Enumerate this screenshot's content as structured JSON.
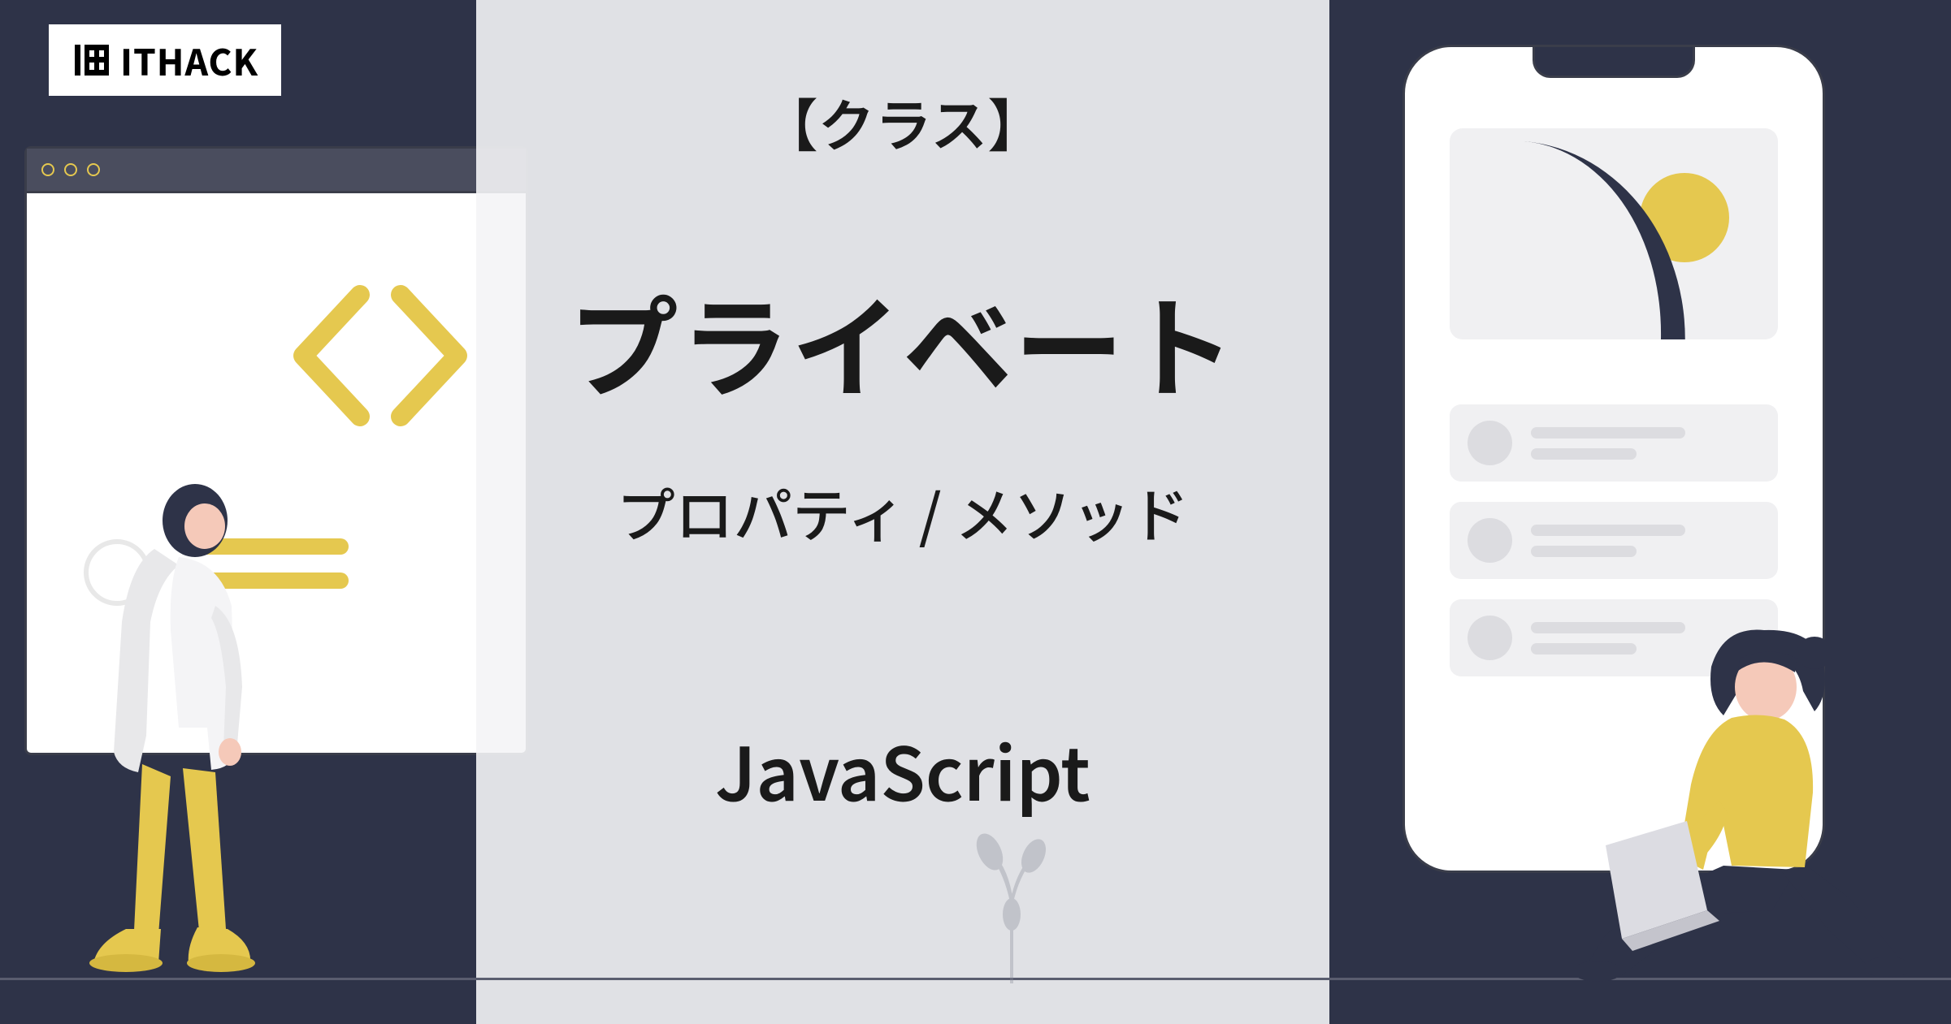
{
  "logo": {
    "text": "ITHACK",
    "icon": "ithack-logo-icon"
  },
  "content": {
    "tag": "【クラス】",
    "title": "プライベート",
    "subtitle": "プロパティ / メソッド",
    "footer": "JavaScript"
  },
  "colors": {
    "background": "#2e3348",
    "accent": "#e5c84f",
    "panel": "#f4f4f6",
    "text": "#1a1a1a"
  },
  "decorations": {
    "browser_dots": 3,
    "phone_cards": 3,
    "code_bracket_left": "<",
    "code_bracket_right": ">"
  }
}
